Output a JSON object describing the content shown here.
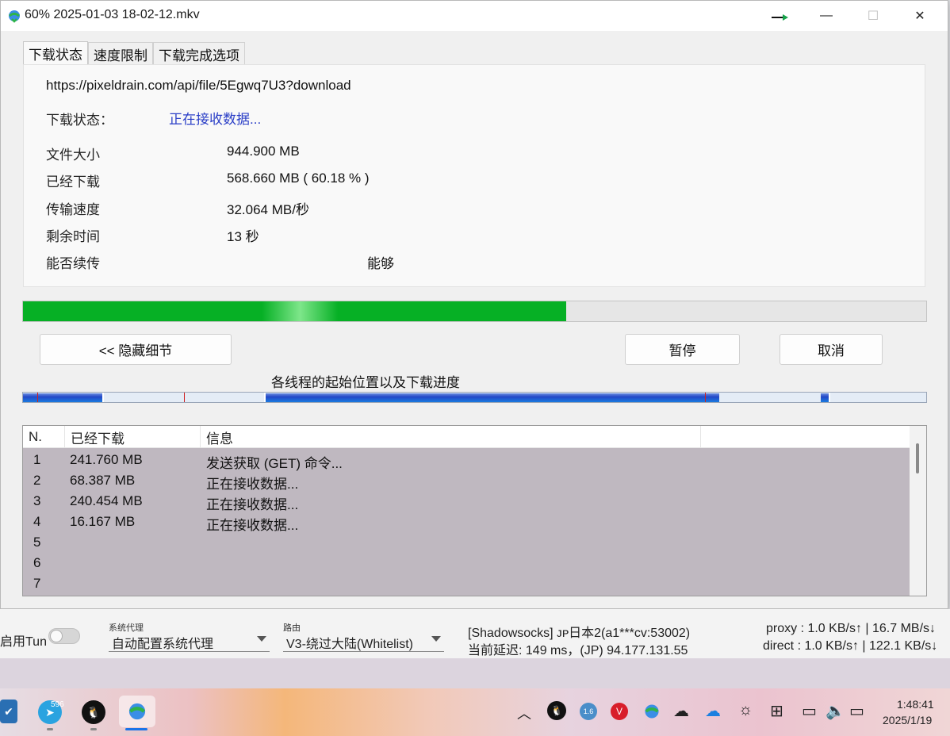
{
  "window": {
    "title": "60% 2025-01-03 18-02-12.mkv",
    "controls": {
      "minimize": "—",
      "maximize": "☐",
      "close": "✕"
    }
  },
  "tabs": [
    {
      "label": "下载状态",
      "active": true
    },
    {
      "label": "速度限制",
      "active": false
    },
    {
      "label": "下载完成选项",
      "active": false
    }
  ],
  "details": {
    "url": "https://pixeldrain.com/api/file/5Egwq7U3?download",
    "status_label": "下载状态：",
    "status_value": "正在接收数据...",
    "file_size_label": "文件大小",
    "file_size_value": "944.900  MB",
    "downloaded_label": "已经下载",
    "downloaded_value": "568.660  MB  ( 60.18 % )",
    "speed_label": "传输速度",
    "speed_value": "32.064  MB/秒",
    "remaining_label": "剩余时间",
    "remaining_value": "13  秒",
    "resume_label": "能否续传",
    "resume_value": "能够"
  },
  "progress": {
    "percent": 60.18,
    "color": "#06b025"
  },
  "buttons": {
    "hide_details": "<< 隐藏细节",
    "pause": "暂停",
    "cancel": "取消"
  },
  "threads": {
    "caption": "各线程的起始位置以及下载进度"
  },
  "connections": {
    "headers": [
      "N.",
      "已经下载",
      "信息",
      ""
    ],
    "rows": [
      {
        "n": "1",
        "downloaded": "241.760  MB",
        "info": "发送获取 (GET) 命令..."
      },
      {
        "n": "2",
        "downloaded": "68.387  MB",
        "info": "正在接收数据..."
      },
      {
        "n": "3",
        "downloaded": "240.454  MB",
        "info": "正在接收数据..."
      },
      {
        "n": "4",
        "downloaded": "16.167  MB",
        "info": "正在接收数据..."
      },
      {
        "n": "5",
        "downloaded": "",
        "info": ""
      },
      {
        "n": "6",
        "downloaded": "",
        "info": ""
      },
      {
        "n": "7",
        "downloaded": "",
        "info": ""
      }
    ]
  },
  "clash": {
    "tun_label": "启用Tun",
    "proxy_caption": "系统代理",
    "proxy_value": "自动配置系统代理",
    "route_caption": "路由",
    "route_value": "V3-绕过大陆(Whitelist)",
    "server_line": "[Shadowsocks] ᴊᴘ日本2(a1***cv:53002)",
    "latency_line": "当前延迟: 149 ms，(JP) 94.177.131.55",
    "proxy_speed": "proxy : 1.0 KB/s↑ | 16.7 MB/s↓",
    "direct_speed": "direct : 1.0 KB/s↑ | 122.1 KB/s↓"
  },
  "taskbar": {
    "telegram_badge": "596",
    "tray_badge": "1.6",
    "clock_time": "1:48:41",
    "clock_date": "2025/1/19"
  }
}
